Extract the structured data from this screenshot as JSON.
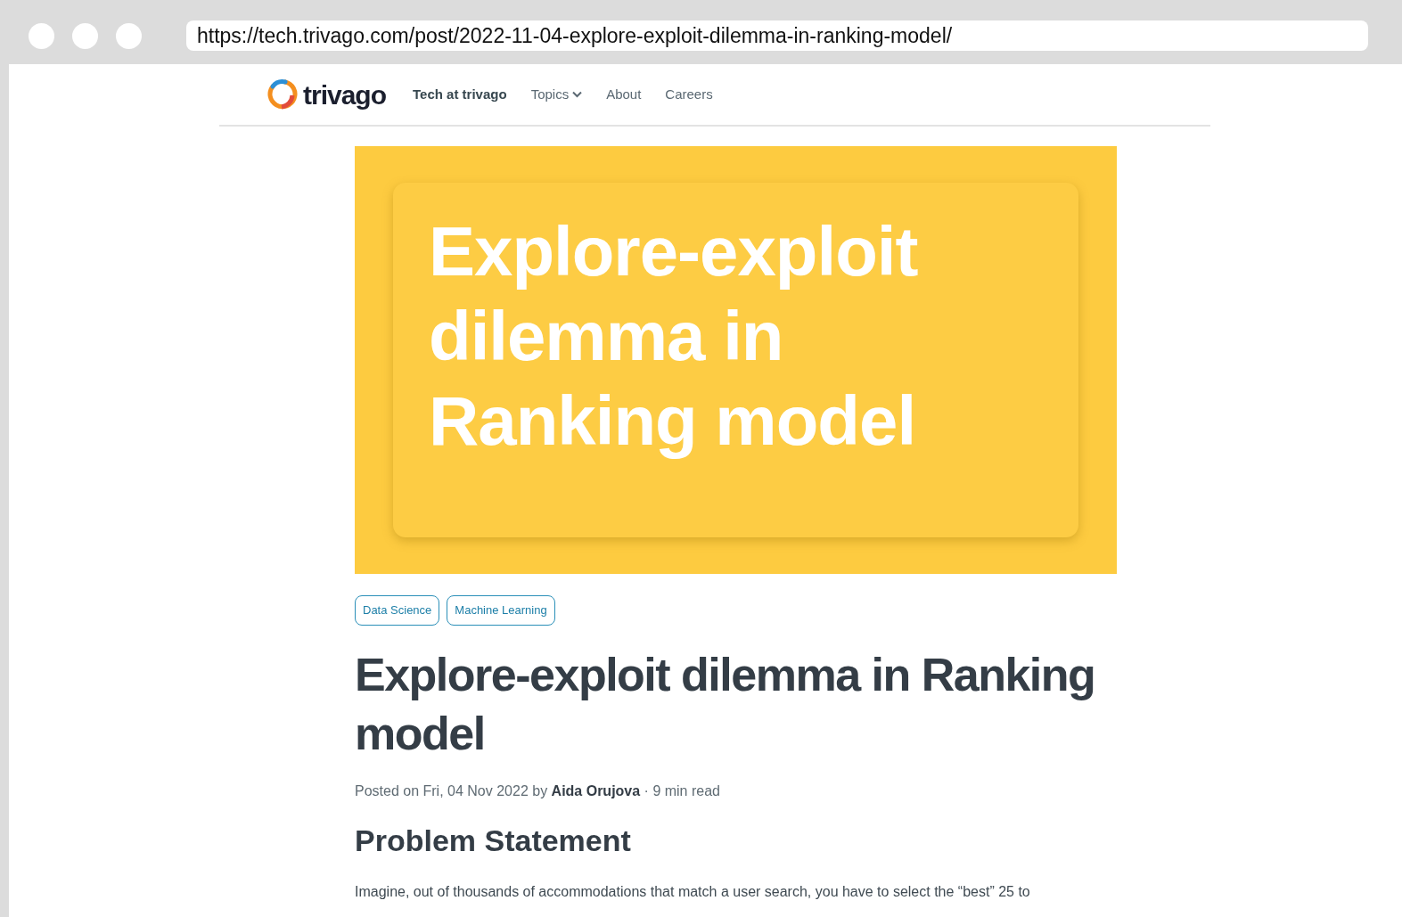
{
  "browser": {
    "url": "https://tech.trivago.com/post/2022-11-04-explore-exploit-dilemma-in-ranking-model/"
  },
  "navbar": {
    "logo": "trivago",
    "brand": "Tech at trivago",
    "links": [
      {
        "label": "Topics",
        "kind": "dropdown"
      },
      {
        "label": "About",
        "kind": "link"
      },
      {
        "label": "Careers",
        "kind": "link"
      }
    ]
  },
  "hero": {
    "lines": [
      "Explore-exploit",
      "dilemma in",
      "Ranking model"
    ]
  },
  "tags": [
    "Data Science",
    "Machine Learning"
  ],
  "title": "Explore-exploit dilemma in Ranking model",
  "meta": "Posted on Fri, 04 Nov 2022 by **Aida Orujova** · 9 min read",
  "heading": "Problem Statement",
  "paragraph": "Imagine, out of thousands of accommodations that match a user search, you have to select the “best” 25 to"
}
